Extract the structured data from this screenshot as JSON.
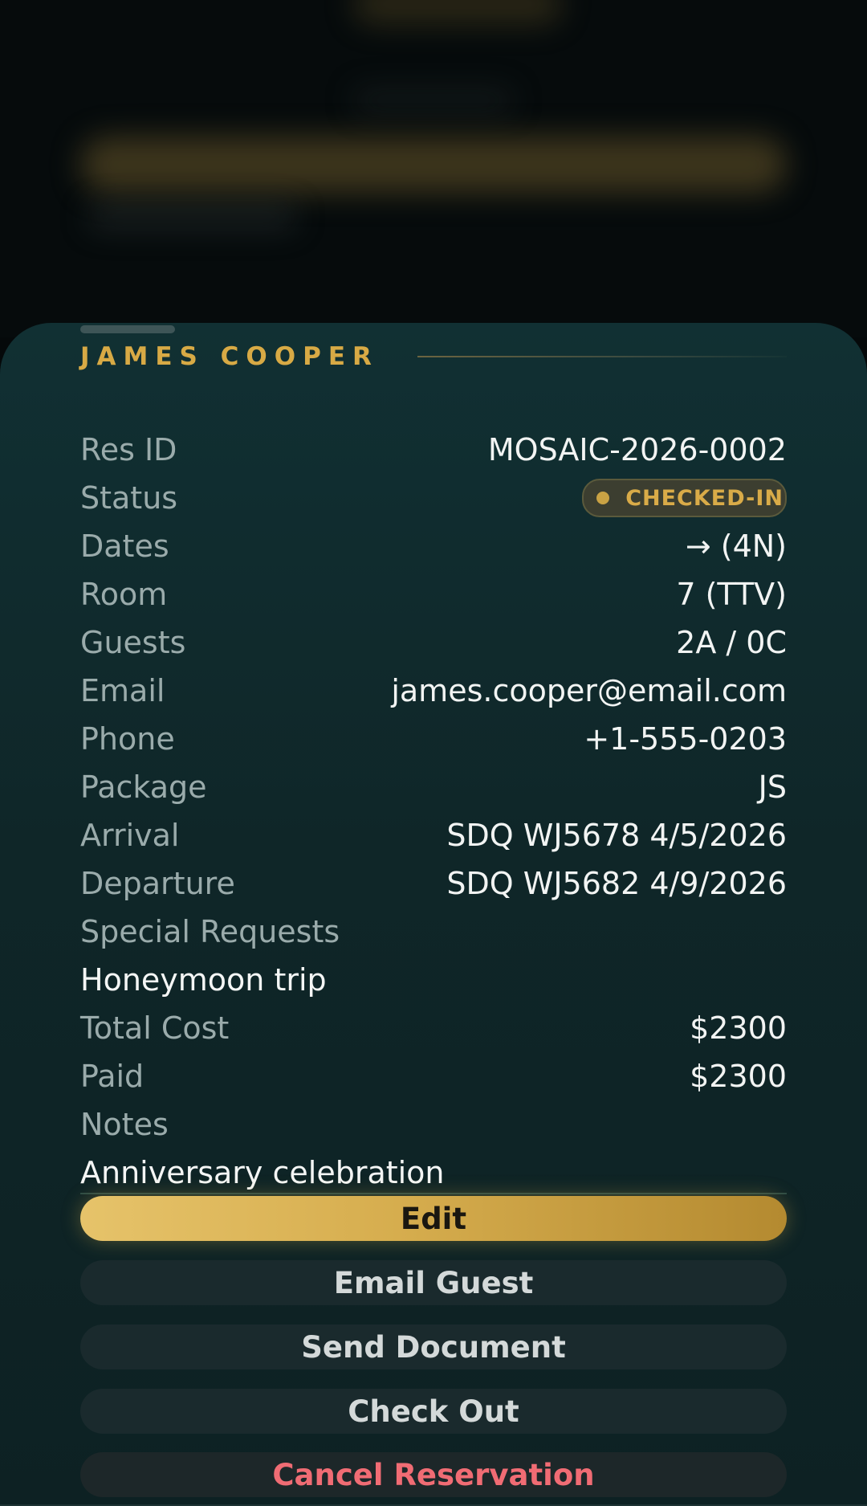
{
  "guest": {
    "name": "JAMES COOPER"
  },
  "details": {
    "res_id": {
      "label": "Res ID",
      "value": "MOSAIC-2026-0002"
    },
    "status": {
      "label": "Status",
      "value": "CHECKED-IN"
    },
    "dates": {
      "label": "Dates",
      "value": "→ (4N)"
    },
    "room": {
      "label": "Room",
      "value": "7 (TTV)"
    },
    "guests": {
      "label": "Guests",
      "value": "2A / 0C"
    },
    "email": {
      "label": "Email",
      "value": "james.cooper@email.com"
    },
    "phone": {
      "label": "Phone",
      "value": "+1-555-0203"
    },
    "package": {
      "label": "Package",
      "value": "JS"
    },
    "arrival": {
      "label": "Arrival",
      "value": "SDQ WJ5678 4/5/2026"
    },
    "departure": {
      "label": "Departure",
      "value": "SDQ WJ5682 4/9/2026"
    },
    "special_requests": {
      "label": "Special Requests",
      "value": "Honeymoon trip"
    },
    "total_cost": {
      "label": "Total Cost",
      "value": "$2300"
    },
    "paid": {
      "label": "Paid",
      "value": "$2300"
    },
    "notes": {
      "label": "Notes",
      "value": "Anniversary celebration"
    }
  },
  "actions": {
    "edit": "Edit",
    "email_guest": "Email Guest",
    "send_document": "Send Document",
    "check_out": "Check Out",
    "cancel": "Cancel Reservation"
  },
  "colors": {
    "accent_gold": "#d8aa45",
    "sheet_bg": "#0f2628",
    "danger": "#f06c74"
  }
}
